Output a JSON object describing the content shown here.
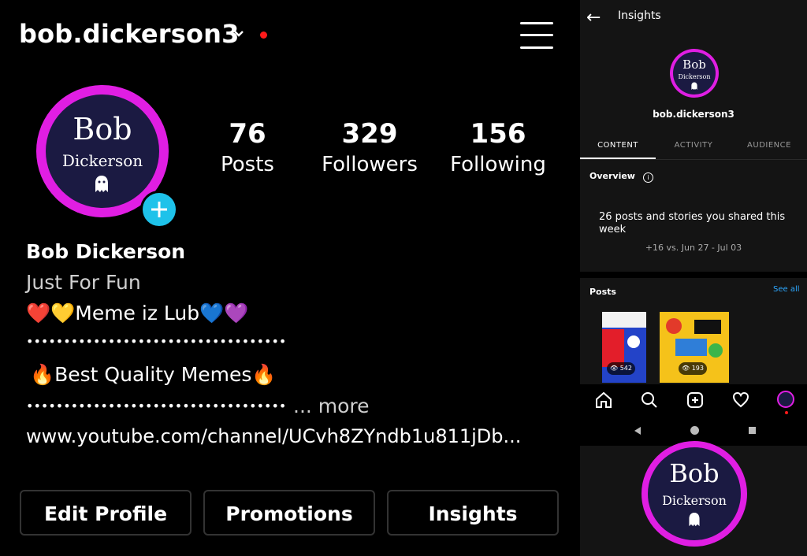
{
  "profile": {
    "username": "bob.dickerson3",
    "avatar_line1": "Bob",
    "avatar_line2": "Dickerson",
    "stats": [
      {
        "value": "76",
        "label": "Posts"
      },
      {
        "value": "329",
        "label": "Followers"
      },
      {
        "value": "156",
        "label": "Following"
      }
    ],
    "display_name": "Bob Dickerson",
    "category": "Just For Fun",
    "bio_line1": "❤️💛Meme iz Lub💙💜",
    "bio_dots1": "•••••••••••••••••••••••••••••••••••",
    "bio_line2": "🔥Best Quality Memes🔥",
    "bio_dots2": "•••••••••••••••••••••••••••••••••••",
    "more": "... more",
    "link": "www.youtube.com/channel/UCvh8ZYndb1u811jDb..."
  },
  "buttons": {
    "edit": "Edit Profile",
    "promotions": "Promotions",
    "insights": "Insights"
  },
  "insights_panel": {
    "title": "Insights",
    "username": "bob.dickerson3",
    "tabs": [
      "CONTENT",
      "ACTIVITY",
      "AUDIENCE"
    ],
    "overview_label": "Overview",
    "summary": "26 posts and stories you shared this week",
    "comparison": "+16 vs. Jun 27 - Jul 03",
    "posts_label": "Posts",
    "see_all": "See all",
    "thumb_views": [
      "542",
      "193"
    ]
  },
  "colors": {
    "background": "#000000",
    "ring": "#e01ee3",
    "plus_badge": "#1ec2ea",
    "notification_dot": "#ff1a1a",
    "link_blue": "#2da8ff"
  }
}
